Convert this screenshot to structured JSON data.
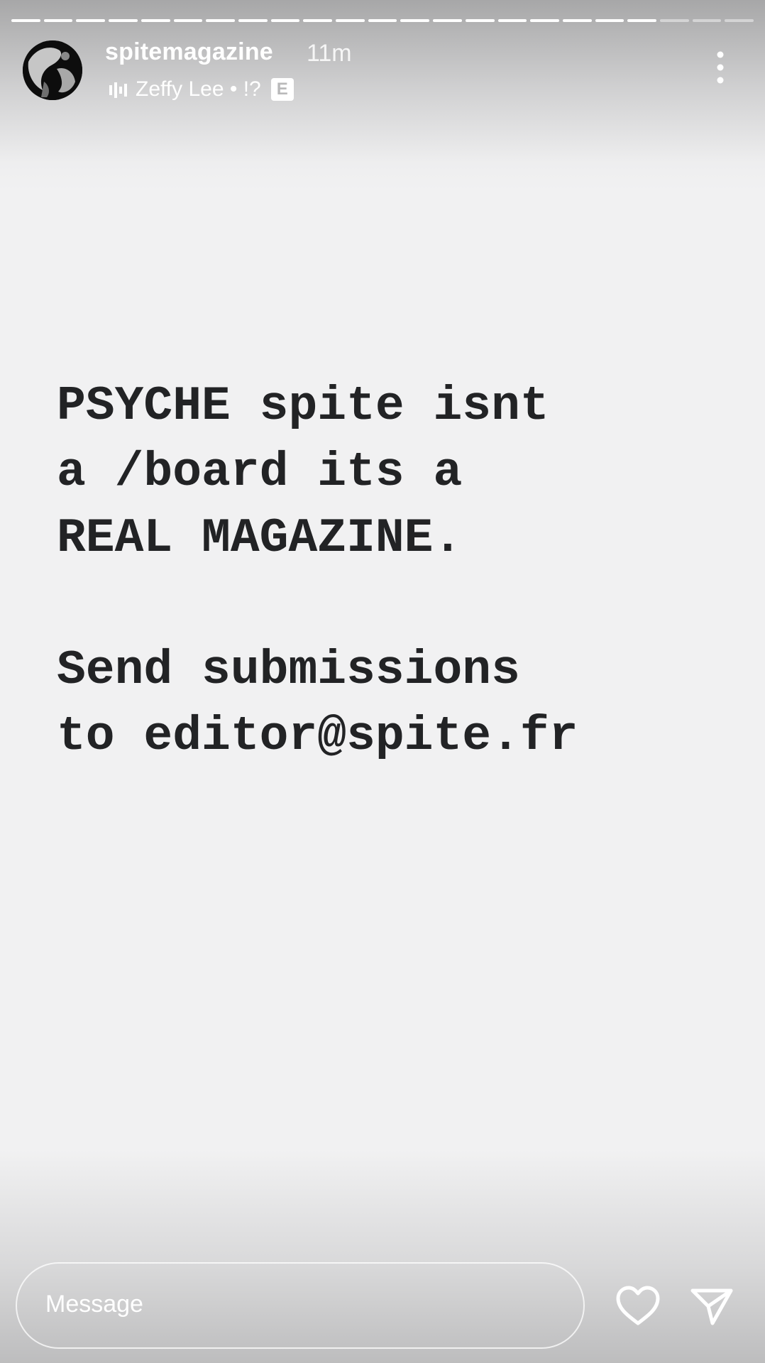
{
  "story": {
    "progress": {
      "total_segments": 23,
      "completed_segments": 20
    }
  },
  "header": {
    "username": "spitemagazine",
    "timestamp": "11m",
    "avatar_icon": "profile-photo",
    "music": {
      "icon": "audio-bars-icon",
      "track": "Zeffy Lee • !?",
      "explicit_badge": "E"
    },
    "more_icon": "more-vertical-icon"
  },
  "caption": {
    "lines": [
      "PSYCHE spite isnt",
      "a /board its a",
      "REAL MAGAZINE.",
      "",
      "Send submissions",
      "to editor@spite.fr"
    ]
  },
  "footer": {
    "message_placeholder": "Message",
    "like_icon": "heart-icon",
    "send_icon": "paper-plane-icon"
  },
  "colors": {
    "background": "#f1f1f2",
    "caption_text": "#222325",
    "overlay_text": "#ffffff"
  }
}
